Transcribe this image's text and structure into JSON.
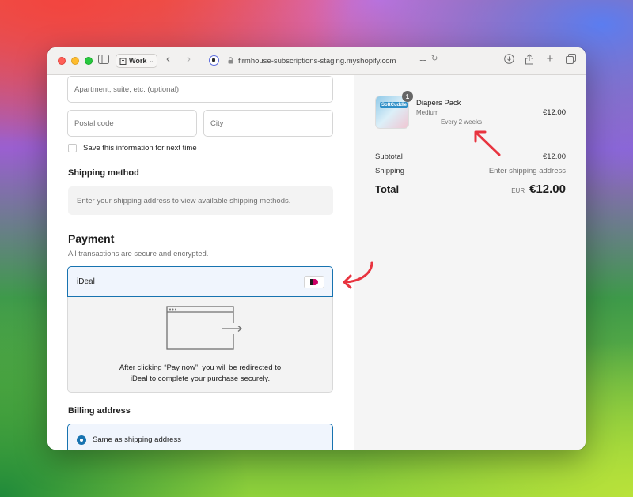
{
  "browser": {
    "profile_label": "Work",
    "url": "firmhouse-subscriptions-staging.myshopify.com"
  },
  "form": {
    "apartment_placeholder": "Apartment, suite, etc. (optional)",
    "postal_placeholder": "Postal code",
    "city_placeholder": "City",
    "save_info_label": "Save this information for next time",
    "shipping_method_title": "Shipping method",
    "shipping_method_info": "Enter your shipping address to view available shipping methods.",
    "payment_title": "Payment",
    "payment_subtitle": "All transactions are secure and encrypted.",
    "payment_option": "iDeal",
    "redirect_line1": "After clicking “Pay now”, you will be redirected to",
    "redirect_line2": "iDeal to complete your purchase securely.",
    "billing_title": "Billing address",
    "billing_option": "Same as shipping address"
  },
  "summary": {
    "product_name": "Diapers Pack",
    "product_brand": "SoftCuddle",
    "variant": "Medium",
    "plan": "Every 2 weeks",
    "quantity": "1",
    "price": "€12.00",
    "subtotal_label": "Subtotal",
    "subtotal_value": "€12.00",
    "shipping_label": "Shipping",
    "shipping_value": "Enter shipping address",
    "total_label": "Total",
    "currency": "EUR",
    "total_value": "€12.00"
  },
  "colors": {
    "accent": "#1773b0",
    "annotation": "#e8343f"
  }
}
